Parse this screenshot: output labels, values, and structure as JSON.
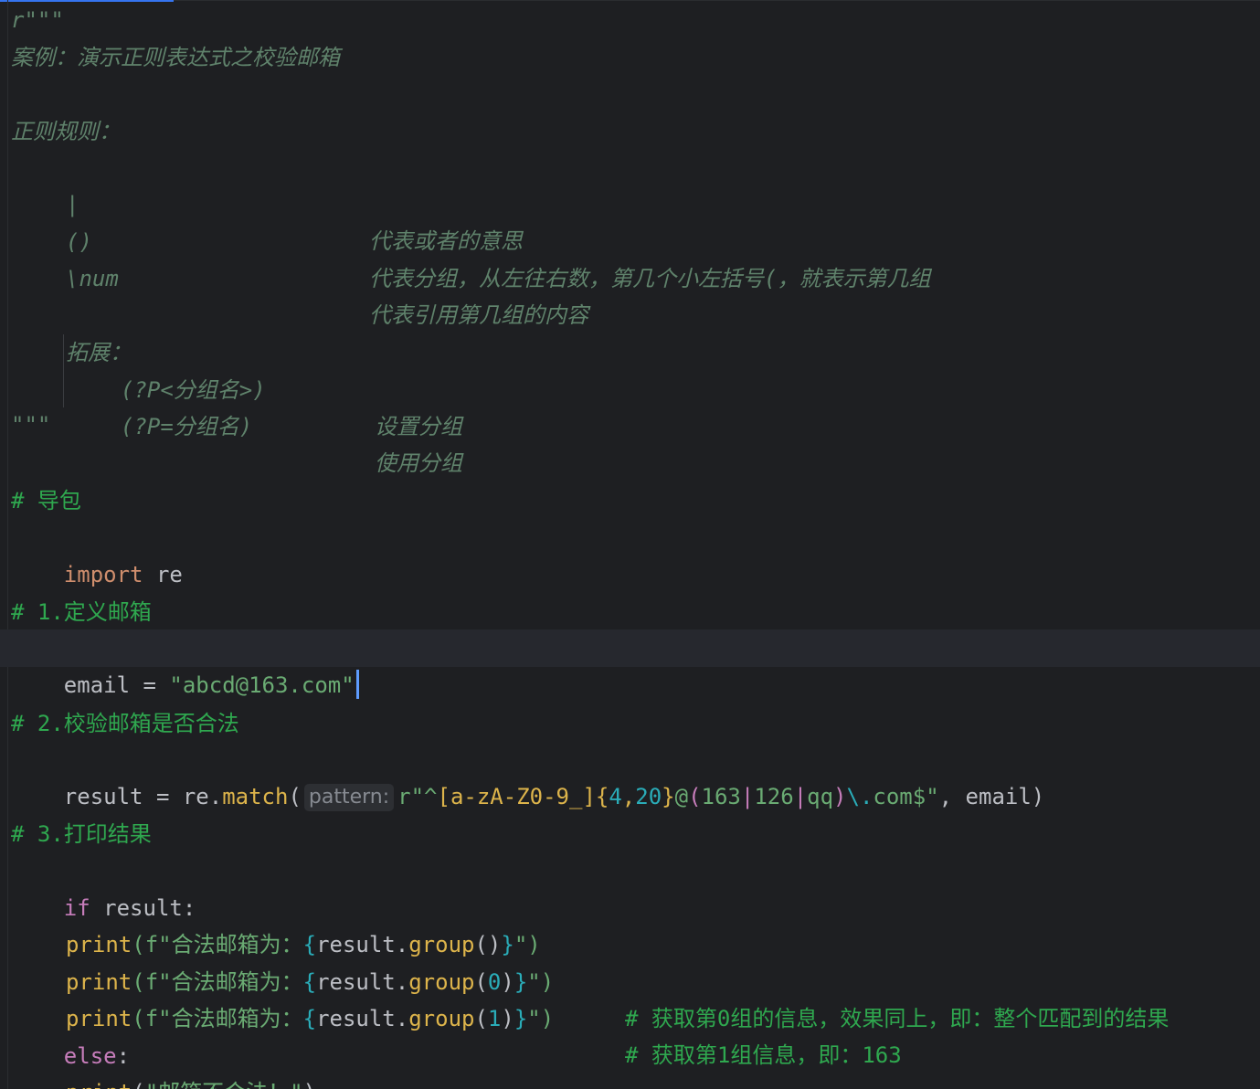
{
  "editor": {
    "docstring": {
      "open": "r\"\"\"",
      "title": "案例：演示正则表达式之校验邮箱",
      "rules_heading": "正则规则：",
      "rules": [
        {
          "symbol": "|",
          "desc": "代表或者的意思"
        },
        {
          "symbol": "()",
          "desc": "代表分组，从左往右数，第几个小左括号(，就表示第几组"
        },
        {
          "symbol": "\\num",
          "desc": "代表引用第几组的内容"
        }
      ],
      "ext_heading": "拓展：",
      "ext": [
        {
          "symbol": "(?P<分组名>)",
          "desc": "设置分组"
        },
        {
          "symbol": "(?P=分组名)",
          "desc": "使用分组"
        }
      ],
      "close": "\"\"\""
    },
    "code": {
      "comment_import": "# 导包",
      "import_kw": "import",
      "import_mod": " re",
      "comment_define": "# 1.定义邮箱",
      "email_var": "email = ",
      "email_val": "\"abcd@163.com\"",
      "comment_check": "# 2.校验邮箱是否合法",
      "result_assign": "result = re.",
      "match_fn": "match",
      "open_paren": "(",
      "param_hint": "pattern:",
      "regex_prefix": "r\"^",
      "regex_class": "[a-zA-Z0-9_]",
      "regex_quant_open": "{",
      "regex_quant_a": "4",
      "regex_quant_comma": ",",
      "regex_quant_b": "20",
      "regex_quant_close": "}",
      "regex_at": "@",
      "regex_group_open": "(",
      "regex_alt1": "163",
      "regex_pipe1": "|",
      "regex_alt2": "126",
      "regex_pipe2": "|",
      "regex_alt3": "qq",
      "regex_group_close": ")",
      "regex_escape": "\\.",
      "regex_tail": "com$\"",
      "match_rest": ", email)",
      "comment_print": "# 3.打印结果",
      "if_kw": "if",
      "if_rest": " result:",
      "print_fn": "print",
      "print1_a": "(f\"合法邮箱为：",
      "print1_b": "result.",
      "print1_c": "group",
      "print1_d": "()",
      "print1_e": "\")",
      "print2_arg": "0",
      "print2_comment": "# 获取第0组的信息，效果同上，即：整个匹配到的结果",
      "print3_arg": "1",
      "print3_comment": "# 获取第1组信息，即：163",
      "brace_open": "{",
      "brace_close": "}",
      "paren_open": "(",
      "paren_close": ")",
      "else_kw": "else",
      "else_colon": ":",
      "print4_open": "(",
      "print4_str": "\"邮箱不合法！\"",
      "print4_close": ")"
    }
  }
}
